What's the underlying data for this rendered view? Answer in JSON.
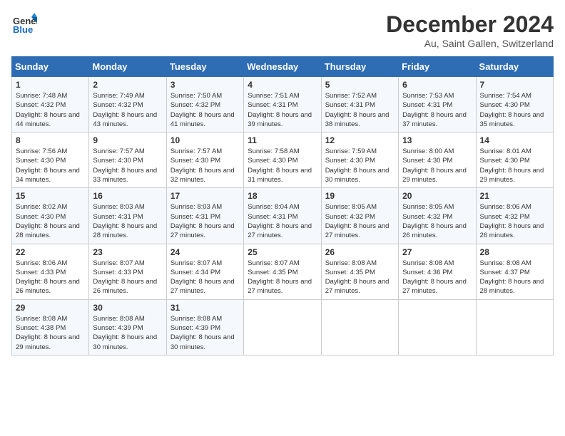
{
  "header": {
    "logo_line1": "General",
    "logo_line2": "Blue",
    "title": "December 2024",
    "subtitle": "Au, Saint Gallen, Switzerland"
  },
  "days_of_week": [
    "Sunday",
    "Monday",
    "Tuesday",
    "Wednesday",
    "Thursday",
    "Friday",
    "Saturday"
  ],
  "weeks": [
    [
      {
        "day": "1",
        "sunrise": "Sunrise: 7:48 AM",
        "sunset": "Sunset: 4:32 PM",
        "daylight": "Daylight: 8 hours and 44 minutes."
      },
      {
        "day": "2",
        "sunrise": "Sunrise: 7:49 AM",
        "sunset": "Sunset: 4:32 PM",
        "daylight": "Daylight: 8 hours and 43 minutes."
      },
      {
        "day": "3",
        "sunrise": "Sunrise: 7:50 AM",
        "sunset": "Sunset: 4:32 PM",
        "daylight": "Daylight: 8 hours and 41 minutes."
      },
      {
        "day": "4",
        "sunrise": "Sunrise: 7:51 AM",
        "sunset": "Sunset: 4:31 PM",
        "daylight": "Daylight: 8 hours and 39 minutes."
      },
      {
        "day": "5",
        "sunrise": "Sunrise: 7:52 AM",
        "sunset": "Sunset: 4:31 PM",
        "daylight": "Daylight: 8 hours and 38 minutes."
      },
      {
        "day": "6",
        "sunrise": "Sunrise: 7:53 AM",
        "sunset": "Sunset: 4:31 PM",
        "daylight": "Daylight: 8 hours and 37 minutes."
      },
      {
        "day": "7",
        "sunrise": "Sunrise: 7:54 AM",
        "sunset": "Sunset: 4:30 PM",
        "daylight": "Daylight: 8 hours and 35 minutes."
      }
    ],
    [
      {
        "day": "8",
        "sunrise": "Sunrise: 7:56 AM",
        "sunset": "Sunset: 4:30 PM",
        "daylight": "Daylight: 8 hours and 34 minutes."
      },
      {
        "day": "9",
        "sunrise": "Sunrise: 7:57 AM",
        "sunset": "Sunset: 4:30 PM",
        "daylight": "Daylight: 8 hours and 33 minutes."
      },
      {
        "day": "10",
        "sunrise": "Sunrise: 7:57 AM",
        "sunset": "Sunset: 4:30 PM",
        "daylight": "Daylight: 8 hours and 32 minutes."
      },
      {
        "day": "11",
        "sunrise": "Sunrise: 7:58 AM",
        "sunset": "Sunset: 4:30 PM",
        "daylight": "Daylight: 8 hours and 31 minutes."
      },
      {
        "day": "12",
        "sunrise": "Sunrise: 7:59 AM",
        "sunset": "Sunset: 4:30 PM",
        "daylight": "Daylight: 8 hours and 30 minutes."
      },
      {
        "day": "13",
        "sunrise": "Sunrise: 8:00 AM",
        "sunset": "Sunset: 4:30 PM",
        "daylight": "Daylight: 8 hours and 29 minutes."
      },
      {
        "day": "14",
        "sunrise": "Sunrise: 8:01 AM",
        "sunset": "Sunset: 4:30 PM",
        "daylight": "Daylight: 8 hours and 29 minutes."
      }
    ],
    [
      {
        "day": "15",
        "sunrise": "Sunrise: 8:02 AM",
        "sunset": "Sunset: 4:30 PM",
        "daylight": "Daylight: 8 hours and 28 minutes."
      },
      {
        "day": "16",
        "sunrise": "Sunrise: 8:03 AM",
        "sunset": "Sunset: 4:31 PM",
        "daylight": "Daylight: 8 hours and 28 minutes."
      },
      {
        "day": "17",
        "sunrise": "Sunrise: 8:03 AM",
        "sunset": "Sunset: 4:31 PM",
        "daylight": "Daylight: 8 hours and 27 minutes."
      },
      {
        "day": "18",
        "sunrise": "Sunrise: 8:04 AM",
        "sunset": "Sunset: 4:31 PM",
        "daylight": "Daylight: 8 hours and 27 minutes."
      },
      {
        "day": "19",
        "sunrise": "Sunrise: 8:05 AM",
        "sunset": "Sunset: 4:32 PM",
        "daylight": "Daylight: 8 hours and 27 minutes."
      },
      {
        "day": "20",
        "sunrise": "Sunrise: 8:05 AM",
        "sunset": "Sunset: 4:32 PM",
        "daylight": "Daylight: 8 hours and 26 minutes."
      },
      {
        "day": "21",
        "sunrise": "Sunrise: 8:06 AM",
        "sunset": "Sunset: 4:32 PM",
        "daylight": "Daylight: 8 hours and 26 minutes."
      }
    ],
    [
      {
        "day": "22",
        "sunrise": "Sunrise: 8:06 AM",
        "sunset": "Sunset: 4:33 PM",
        "daylight": "Daylight: 8 hours and 26 minutes."
      },
      {
        "day": "23",
        "sunrise": "Sunrise: 8:07 AM",
        "sunset": "Sunset: 4:33 PM",
        "daylight": "Daylight: 8 hours and 26 minutes."
      },
      {
        "day": "24",
        "sunrise": "Sunrise: 8:07 AM",
        "sunset": "Sunset: 4:34 PM",
        "daylight": "Daylight: 8 hours and 27 minutes."
      },
      {
        "day": "25",
        "sunrise": "Sunrise: 8:07 AM",
        "sunset": "Sunset: 4:35 PM",
        "daylight": "Daylight: 8 hours and 27 minutes."
      },
      {
        "day": "26",
        "sunrise": "Sunrise: 8:08 AM",
        "sunset": "Sunset: 4:35 PM",
        "daylight": "Daylight: 8 hours and 27 minutes."
      },
      {
        "day": "27",
        "sunrise": "Sunrise: 8:08 AM",
        "sunset": "Sunset: 4:36 PM",
        "daylight": "Daylight: 8 hours and 27 minutes."
      },
      {
        "day": "28",
        "sunrise": "Sunrise: 8:08 AM",
        "sunset": "Sunset: 4:37 PM",
        "daylight": "Daylight: 8 hours and 28 minutes."
      }
    ],
    [
      {
        "day": "29",
        "sunrise": "Sunrise: 8:08 AM",
        "sunset": "Sunset: 4:38 PM",
        "daylight": "Daylight: 8 hours and 29 minutes."
      },
      {
        "day": "30",
        "sunrise": "Sunrise: 8:08 AM",
        "sunset": "Sunset: 4:39 PM",
        "daylight": "Daylight: 8 hours and 30 minutes."
      },
      {
        "day": "31",
        "sunrise": "Sunrise: 8:08 AM",
        "sunset": "Sunset: 4:39 PM",
        "daylight": "Daylight: 8 hours and 30 minutes."
      },
      null,
      null,
      null,
      null
    ]
  ]
}
